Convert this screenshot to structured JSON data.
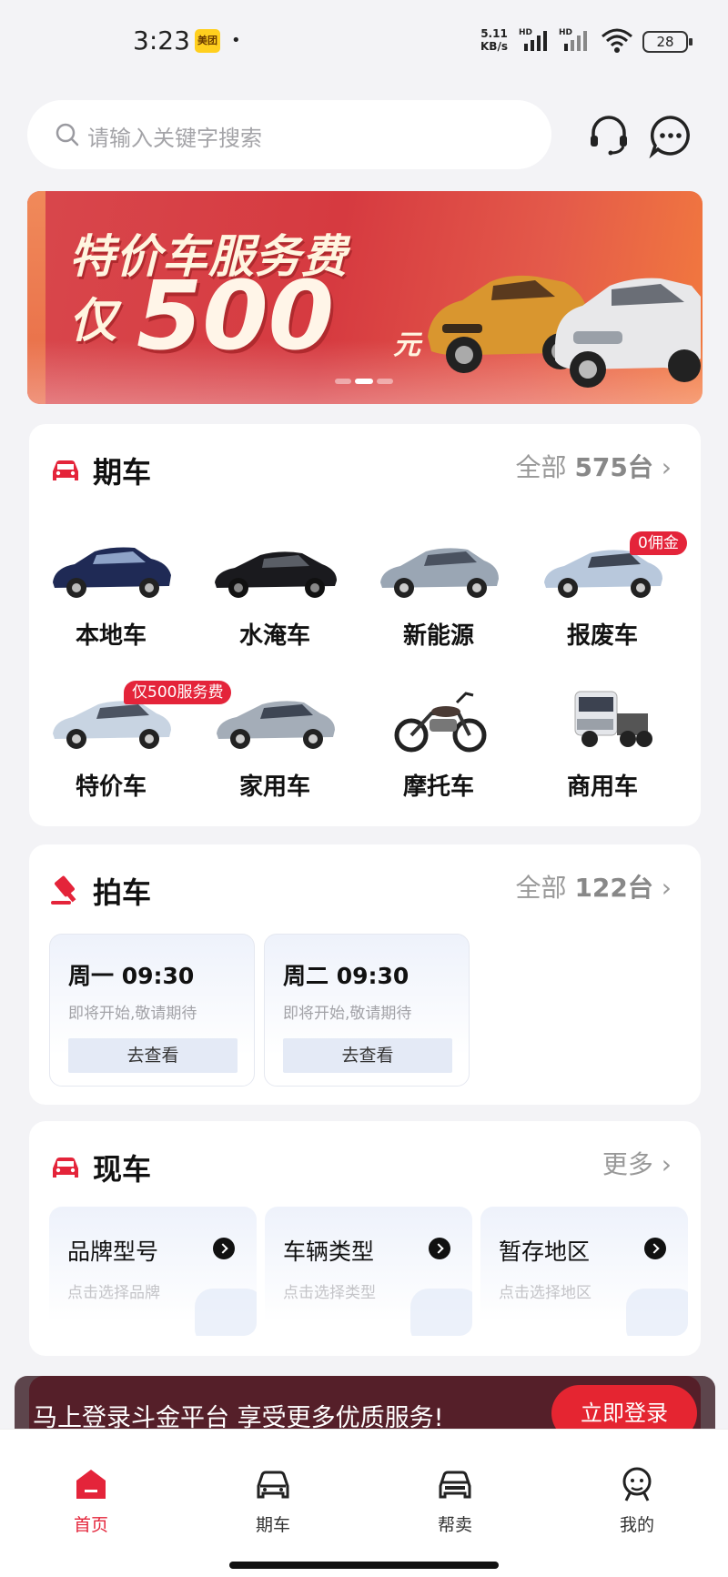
{
  "status_bar": {
    "time": "3:23",
    "app_badge": "美团",
    "dot": "•",
    "net_speed_value": "5.11",
    "net_speed_unit": "KB/s",
    "sim1": "HD",
    "sim2": "HD",
    "battery": "28"
  },
  "search": {
    "placeholder": "请输入关键字搜索"
  },
  "header_icons": [
    "headset-icon",
    "chat-icon"
  ],
  "banner": {
    "line1": "特价车服务费",
    "line2_prefix": "仅",
    "line2_amount": "500",
    "line2_unit": "元",
    "colors": {
      "bg": "#d63a40",
      "text": "#fff5e0"
    }
  },
  "qiche": {
    "title": "期车",
    "more_prefix": "全部",
    "more_count": "575台",
    "items": [
      {
        "label": "本地车",
        "tag": ""
      },
      {
        "label": "水淹车",
        "tag": ""
      },
      {
        "label": "新能源",
        "tag": ""
      },
      {
        "label": "报废车",
        "tag": "0佣金"
      },
      {
        "label": "特价车",
        "tag": "仅500服务费"
      },
      {
        "label": "家用车",
        "tag": ""
      },
      {
        "label": "摩托车",
        "tag": ""
      },
      {
        "label": "商用车",
        "tag": ""
      }
    ]
  },
  "paiche": {
    "title": "拍车",
    "more_prefix": "全部",
    "more_count": "122台",
    "sessions": [
      {
        "day": "周一 09:30",
        "status": "即将开始,敬请期待",
        "button": "去查看"
      },
      {
        "day": "周二 09:30",
        "status": "即将开始,敬请期待",
        "button": "去查看"
      }
    ]
  },
  "xianche": {
    "title": "现车",
    "more": "更多",
    "filters": [
      {
        "title": "品牌型号",
        "hint": "点击选择品牌"
      },
      {
        "title": "车辆类型",
        "hint": "点击选择类型"
      },
      {
        "title": "暂存地区",
        "hint": "点击选择地区"
      }
    ]
  },
  "login_prompt": {
    "message": "马上登录斗金平台 享受更多优质服务!",
    "button": "立即登录"
  },
  "tabbar": {
    "active": 0,
    "items": [
      "首页",
      "期车",
      "帮卖",
      "我的"
    ]
  },
  "colors": {
    "accent": "#e4243a",
    "page_bg": "#f3f3f6"
  }
}
